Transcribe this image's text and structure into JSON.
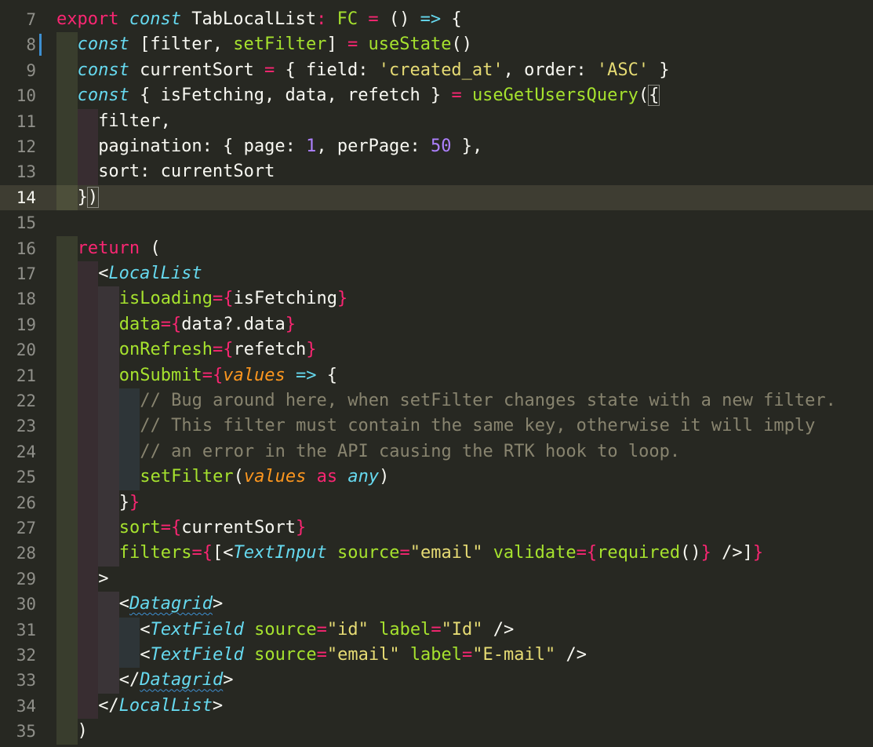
{
  "colors": {
    "background": "#272822",
    "current_line": "#3e3d32",
    "line_number": "#90908a",
    "keyword": "#f92672",
    "storage": "#66d9ef",
    "function": "#a6e22e",
    "string": "#e6db74",
    "number": "#ae81ff",
    "parameter": "#fd971f",
    "comment": "#88846f",
    "plain": "#f8f8f2",
    "change_marker": "#3d8fd1"
  },
  "editor": {
    "first_line": 7,
    "current_line": 14,
    "modified_lines": [
      8
    ],
    "lines": [
      {
        "n": "7",
        "indent": 0,
        "tokens": [
          [
            "export",
            "kw"
          ],
          [
            " ",
            ""
          ],
          [
            "const",
            "sti"
          ],
          [
            " TabLocalList",
            ""
          ],
          [
            ":",
            "kw"
          ],
          [
            " ",
            ""
          ],
          [
            "FC",
            "fn"
          ],
          [
            " = ",
            "kw"
          ],
          [
            "() ",
            ""
          ],
          [
            "=>",
            "st"
          ],
          [
            " {",
            ""
          ]
        ]
      },
      {
        "n": "8",
        "indent": 1,
        "tokens": [
          [
            "const",
            "sti"
          ],
          [
            " [filter, ",
            ""
          ],
          [
            "setFilter",
            "fn"
          ],
          [
            "] ",
            ""
          ],
          [
            "=",
            "kw"
          ],
          [
            " ",
            ""
          ],
          [
            "useState",
            "fn"
          ],
          [
            "()",
            ""
          ]
        ]
      },
      {
        "n": "9",
        "indent": 1,
        "tokens": [
          [
            "const",
            "sti"
          ],
          [
            " currentSort ",
            ""
          ],
          [
            "=",
            "kw"
          ],
          [
            " { field: ",
            ""
          ],
          [
            "'created_at'",
            "str"
          ],
          [
            ", order: ",
            ""
          ],
          [
            "'ASC'",
            "str"
          ],
          [
            " }",
            ""
          ]
        ]
      },
      {
        "n": "10",
        "indent": 1,
        "tokens": [
          [
            "const",
            "sti"
          ],
          [
            " { isFetching, data, refetch } ",
            ""
          ],
          [
            "=",
            "kw"
          ],
          [
            " ",
            ""
          ],
          [
            "useGetUsersQuery",
            "fn"
          ],
          [
            "(",
            ""
          ],
          [
            "{",
            "box"
          ]
        ]
      },
      {
        "n": "11",
        "indent": 2,
        "tokens": [
          [
            "filter,",
            ""
          ]
        ]
      },
      {
        "n": "12",
        "indent": 2,
        "tokens": [
          [
            "pagination: { page: ",
            ""
          ],
          [
            "1",
            "num"
          ],
          [
            ", perPage: ",
            ""
          ],
          [
            "50",
            "num"
          ],
          [
            " },",
            ""
          ]
        ]
      },
      {
        "n": "13",
        "indent": 2,
        "tokens": [
          [
            "sort: currentSort",
            ""
          ]
        ]
      },
      {
        "n": "14",
        "indent": 1,
        "tokens": [
          [
            "}",
            ""
          ],
          [
            ")",
            "box"
          ]
        ]
      },
      {
        "n": "15",
        "indent": 0,
        "tokens": []
      },
      {
        "n": "16",
        "indent": 1,
        "tokens": [
          [
            "return",
            "kw"
          ],
          [
            " (",
            ""
          ]
        ]
      },
      {
        "n": "17",
        "indent": 2,
        "tokens": [
          [
            "<",
            ""
          ],
          [
            "LocalList",
            "sti"
          ]
        ]
      },
      {
        "n": "18",
        "indent": 3,
        "tokens": [
          [
            "isLoading",
            "fn"
          ],
          [
            "=",
            "kw"
          ],
          [
            "{",
            "kw"
          ],
          [
            "isFetching",
            ""
          ],
          [
            "}",
            "kw"
          ]
        ]
      },
      {
        "n": "19",
        "indent": 3,
        "tokens": [
          [
            "data",
            "fn"
          ],
          [
            "=",
            "kw"
          ],
          [
            "{",
            "kw"
          ],
          [
            "data?.data",
            ""
          ],
          [
            "}",
            "kw"
          ]
        ]
      },
      {
        "n": "20",
        "indent": 3,
        "tokens": [
          [
            "onRefresh",
            "fn"
          ],
          [
            "=",
            "kw"
          ],
          [
            "{",
            "kw"
          ],
          [
            "refetch",
            ""
          ],
          [
            "}",
            "kw"
          ]
        ]
      },
      {
        "n": "21",
        "indent": 3,
        "tokens": [
          [
            "onSubmit",
            "fn"
          ],
          [
            "=",
            "kw"
          ],
          [
            "{",
            "kw"
          ],
          [
            "values",
            "pi"
          ],
          [
            " ",
            ""
          ],
          [
            "=>",
            "st"
          ],
          [
            " {",
            ""
          ]
        ]
      },
      {
        "n": "22",
        "indent": 4,
        "tokens": [
          [
            "// Bug around here, when setFilter changes state with a new filter.",
            "cm"
          ]
        ]
      },
      {
        "n": "23",
        "indent": 4,
        "tokens": [
          [
            "// This filter must contain the same key, otherwise it will imply",
            "cm"
          ]
        ]
      },
      {
        "n": "24",
        "indent": 4,
        "tokens": [
          [
            "// an error in the API causing the RTK hook to loop.",
            "cm"
          ]
        ]
      },
      {
        "n": "25",
        "indent": 4,
        "tokens": [
          [
            "setFilter",
            "fn"
          ],
          [
            "(",
            ""
          ],
          [
            "values",
            "pi"
          ],
          [
            " ",
            ""
          ],
          [
            "as",
            "kw"
          ],
          [
            " ",
            ""
          ],
          [
            "any",
            "sti"
          ],
          [
            ")",
            ""
          ]
        ]
      },
      {
        "n": "26",
        "indent": 3,
        "tokens": [
          [
            "}",
            ""
          ],
          [
            "}",
            "kw"
          ]
        ]
      },
      {
        "n": "27",
        "indent": 3,
        "tokens": [
          [
            "sort",
            "fn"
          ],
          [
            "=",
            "kw"
          ],
          [
            "{",
            "kw"
          ],
          [
            "currentSort",
            ""
          ],
          [
            "}",
            "kw"
          ]
        ]
      },
      {
        "n": "28",
        "indent": 3,
        "tokens": [
          [
            "filters",
            "fn"
          ],
          [
            "=",
            "kw"
          ],
          [
            "{",
            "kw"
          ],
          [
            "[<",
            ""
          ],
          [
            "TextInput",
            "sti"
          ],
          [
            " ",
            ""
          ],
          [
            "source",
            "fn"
          ],
          [
            "=",
            "kw"
          ],
          [
            "\"email\"",
            "str"
          ],
          [
            " ",
            ""
          ],
          [
            "validate",
            "fn"
          ],
          [
            "=",
            "kw"
          ],
          [
            "{",
            "kw"
          ],
          [
            "required",
            "fn"
          ],
          [
            "()",
            ""
          ],
          [
            "}",
            "kw"
          ],
          [
            " />]",
            ""
          ],
          [
            "}",
            "kw"
          ]
        ]
      },
      {
        "n": "29",
        "indent": 2,
        "tokens": [
          [
            ">",
            ""
          ]
        ]
      },
      {
        "n": "30",
        "indent": 3,
        "tokens": [
          [
            "<",
            ""
          ],
          [
            "Datagrid",
            "stiw"
          ],
          [
            ">",
            ""
          ]
        ]
      },
      {
        "n": "31",
        "indent": 4,
        "tokens": [
          [
            "<",
            ""
          ],
          [
            "TextField",
            "sti"
          ],
          [
            " ",
            ""
          ],
          [
            "source",
            "fn"
          ],
          [
            "=",
            "kw"
          ],
          [
            "\"id\"",
            "str"
          ],
          [
            " ",
            ""
          ],
          [
            "label",
            "fn"
          ],
          [
            "=",
            "kw"
          ],
          [
            "\"Id\"",
            "str"
          ],
          [
            " />",
            ""
          ]
        ]
      },
      {
        "n": "32",
        "indent": 4,
        "tokens": [
          [
            "<",
            ""
          ],
          [
            "TextField",
            "sti"
          ],
          [
            " ",
            ""
          ],
          [
            "source",
            "fn"
          ],
          [
            "=",
            "kw"
          ],
          [
            "\"email\"",
            "str"
          ],
          [
            " ",
            ""
          ],
          [
            "label",
            "fn"
          ],
          [
            "=",
            "kw"
          ],
          [
            "\"E-mail\"",
            "str"
          ],
          [
            " />",
            ""
          ]
        ]
      },
      {
        "n": "33",
        "indent": 3,
        "tokens": [
          [
            "</",
            ""
          ],
          [
            "Datagrid",
            "stiw"
          ],
          [
            ">",
            ""
          ]
        ]
      },
      {
        "n": "34",
        "indent": 2,
        "tokens": [
          [
            "</",
            ""
          ],
          [
            "LocalList",
            "sti"
          ],
          [
            ">",
            ""
          ]
        ]
      },
      {
        "n": "35",
        "indent": 1,
        "tokens": [
          [
            ")",
            ""
          ]
        ]
      }
    ]
  }
}
